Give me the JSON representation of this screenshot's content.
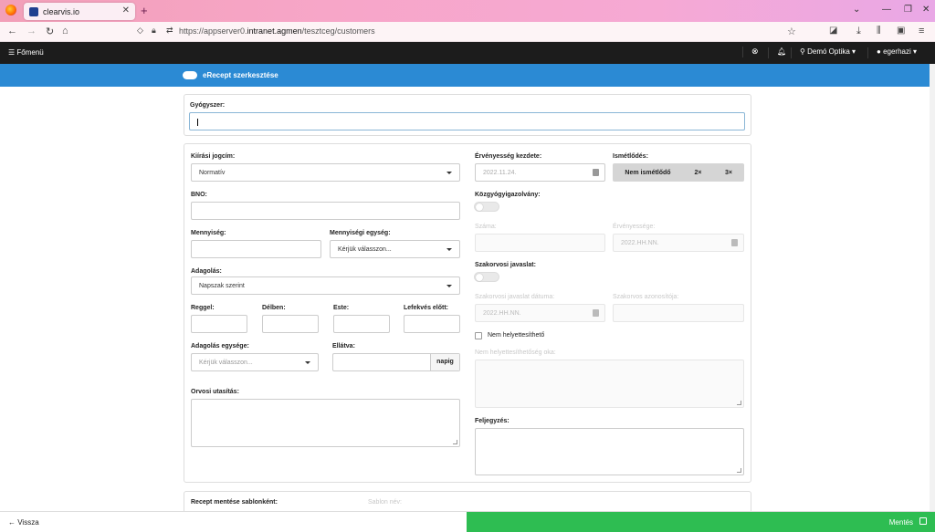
{
  "browser": {
    "tab_title": "clearvis.io",
    "url_prefix": "https://appserver0.",
    "url_host": "intranet.agmen",
    "url_path": "/tesztceg/customers"
  },
  "appbar": {
    "menu_label": "Főmenü",
    "shop_label": "Demó Optika",
    "user_label": "egerhazi"
  },
  "page": {
    "title": "eRecept szerkesztése"
  },
  "drug": {
    "label": "Gyógyszer:"
  },
  "left": {
    "jogcim_label": "Kiírási jogcím:",
    "jogcim_value": "Normatív",
    "bno_label": "BNO:",
    "mennyiseg_label": "Mennyiség:",
    "mennyisegi_egyseg_label": "Mennyiségi egység:",
    "mennyisegi_egyseg_placeholder": "Kérjük válasszon...",
    "adagolas_label": "Adagolás:",
    "adagolas_value": "Napszak szerint",
    "reggel_label": "Reggel:",
    "delben_label": "Délben:",
    "este_label": "Este:",
    "lefekves_label": "Lefekvés előtt:",
    "adagolas_egysege_label": "Adagolás egysége:",
    "adagolas_egysege_placeholder": "Kérjük válasszon...",
    "ellatva_label": "Ellátva:",
    "ellatva_suffix": "napig",
    "orvosi_label": "Orvosi utasítás:"
  },
  "right": {
    "ervenyesseg_kezdete_label": "Érvényesség kezdete:",
    "ervenyesseg_kezdete_value": "2022.11.24.",
    "ismetles_label": "Ismétlődés:",
    "ismetles_options": [
      "Nem ismétlődő",
      "2×",
      "3×"
    ],
    "kozgyogy_label": "Közgyógyigazolvány:",
    "szama_label": "Száma:",
    "ervenyessege_label": "Érvényessége:",
    "ervenyessege_value": "2022.HH.NN.",
    "szakorvosi_label": "Szakorvosi javaslat:",
    "szakorvosi_datum_label": "Szakorvosi javaslat dátuma:",
    "szakorvosi_datum_value": "2022.HH.NN.",
    "szakorvos_azonosito_label": "Szakorvos azonosítója:",
    "nem_helyettesitheto_label": "Nem helyettesíthető",
    "nem_helyettesitheto_ok_label": "Nem helyettesíthetőség oka:",
    "feljegyzes_label": "Feljegyzés:"
  },
  "template": {
    "save_as_label": "Recept mentése sablonként:",
    "name_label": "Sablon név:"
  },
  "footer": {
    "back_label": "Vissza",
    "save_label": "Mentés"
  },
  "colors": {
    "brand_blue": "#2b8ad4",
    "save_green": "#2ebd52",
    "appbar": "#1c1c1c"
  }
}
